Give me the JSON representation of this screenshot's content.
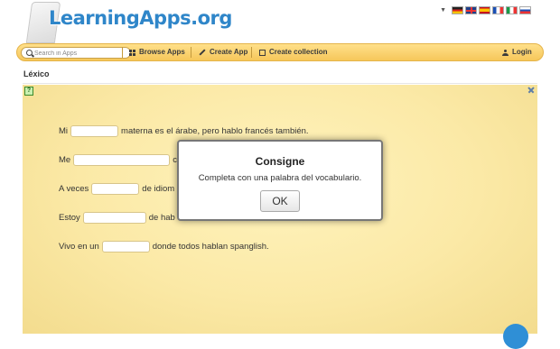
{
  "header": {
    "logo_text": "LearningApps.org",
    "languages": [
      "de",
      "gb",
      "es",
      "fr",
      "it",
      "ru"
    ],
    "language_dropdown_icon": "caret-down-icon"
  },
  "navbar": {
    "search_placeholder": "Search in Apps",
    "browse_apps": "Browse Apps",
    "create_app": "Create App",
    "create_collection": "Create collection",
    "login": "Login"
  },
  "page": {
    "title": "Léxico"
  },
  "exercise": {
    "sentences": [
      {
        "before": "Mi",
        "after": "materna es el árabe, pero hablo francés también."
      },
      {
        "before": "Me",
        "after": "c"
      },
      {
        "before": "A veces",
        "after": "de idiom"
      },
      {
        "before": "Estoy",
        "after": "de hab"
      },
      {
        "before": "Vivo en un",
        "after": "donde todos hablan spanglish."
      }
    ]
  },
  "dialog": {
    "title": "Consigne",
    "message": "Completa con una palabra del vocabulario.",
    "ok_label": "OK"
  },
  "colors": {
    "navbar": "#f6c75a",
    "logo": "#2f86c9",
    "app_background": "#fbe9a6",
    "fab": "#2f8fd6"
  }
}
